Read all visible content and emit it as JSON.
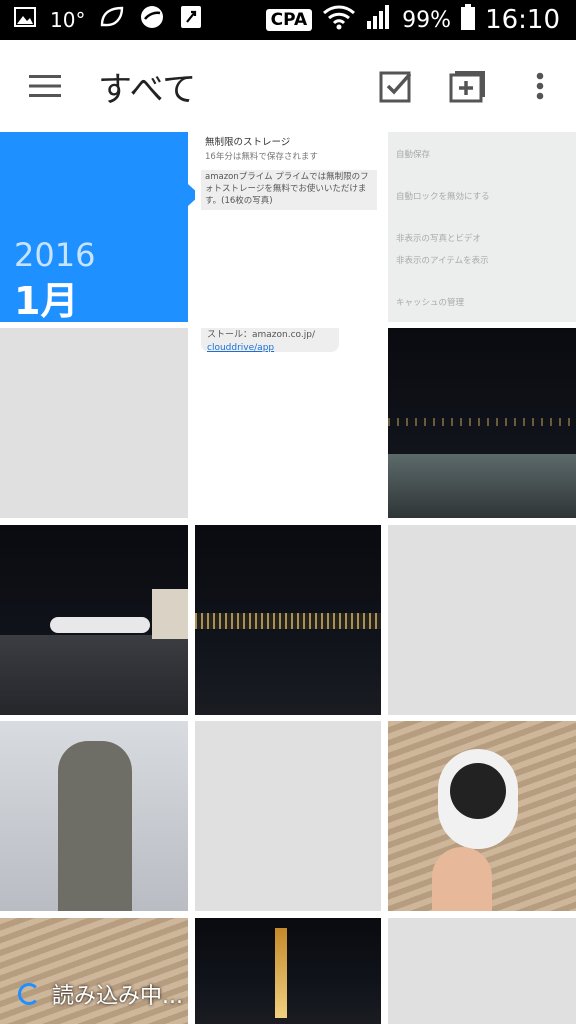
{
  "status_bar": {
    "temperature": "10°",
    "carrier": "CPA",
    "battery": "99%",
    "time": "16:10"
  },
  "toolbar": {
    "title": "すべて"
  },
  "date_tile": {
    "year": "2016",
    "month": "1月"
  },
  "screenshot_tile": {
    "header": "無制限のストレージ",
    "line1": "16年分は無料で保存されます",
    "line2a": "amazonプライム プライムでは無制限のフォトストレージを無料でお使いいただけます。(16枚の写真)",
    "link_prefix": "ストール：amazon.co.jp/",
    "link": "clouddrive/app"
  },
  "settings_tile": {
    "row1": "自動保存",
    "row2": "自動ロックを無効にする",
    "row3": "非表示の写真とビデオ",
    "row4": "非表示のアイテムを表示",
    "row5": "キャッシュの管理"
  },
  "loading": {
    "text": "読み込み中..."
  }
}
